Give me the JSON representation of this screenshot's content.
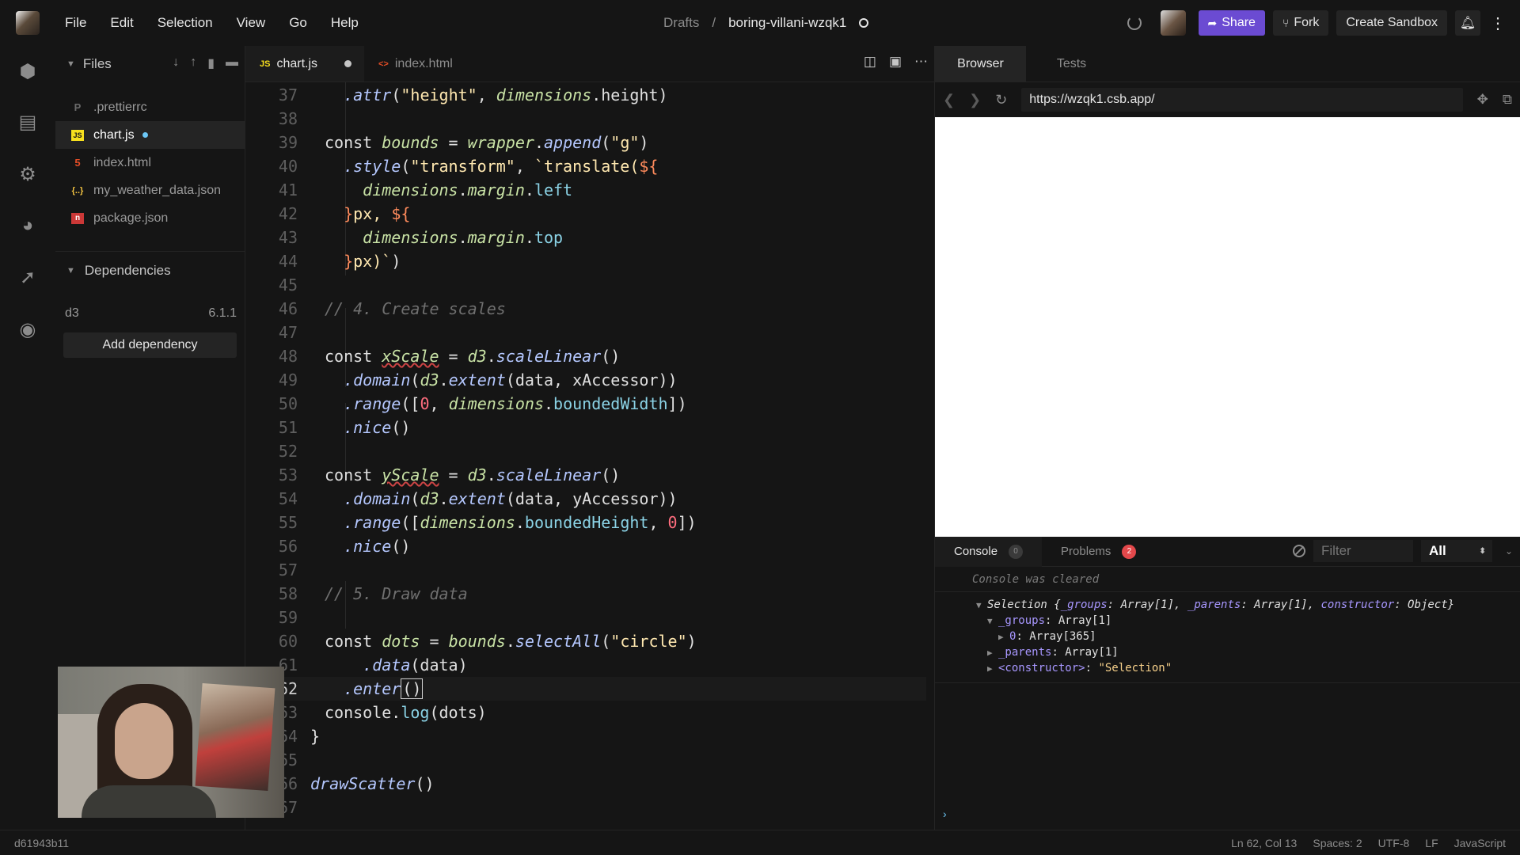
{
  "menu": [
    "File",
    "Edit",
    "Selection",
    "View",
    "Go",
    "Help"
  ],
  "breadcrumb": {
    "folder": "Drafts",
    "separator": "/",
    "sandbox": "boring-villani-wzqk1"
  },
  "header": {
    "share": "Share",
    "fork": "Fork",
    "create": "Create Sandbox"
  },
  "sidebar": {
    "files_title": "Files",
    "files": [
      {
        "name": ".prettierrc",
        "icon": "P"
      },
      {
        "name": "chart.js",
        "icon": "JS"
      },
      {
        "name": "index.html",
        "icon": "5"
      },
      {
        "name": "my_weather_data.json",
        "icon": "{..}"
      },
      {
        "name": "package.json",
        "icon": "n"
      }
    ],
    "deps_title": "Dependencies",
    "deps": [
      {
        "name": "d3",
        "version": "6.1.1"
      }
    ],
    "add_dep": "Add dependency"
  },
  "editor": {
    "tabs": [
      {
        "label": "chart.js",
        "ext": "JS"
      },
      {
        "label": "index.html",
        "ext": "<>"
      }
    ]
  },
  "browser": {
    "tabs": [
      "Browser",
      "Tests"
    ],
    "url": "https://wzqk1.csb.app/"
  },
  "console": {
    "tabs": [
      {
        "label": "Console",
        "count": "0"
      },
      {
        "label": "Problems",
        "count": "2"
      }
    ],
    "filter_placeholder": "Filter",
    "level": "All",
    "cleared": "Console was cleared"
  },
  "status": {
    "hash": "d61943b11",
    "position": "Ln 62, Col 13",
    "spaces": "Spaces: 2",
    "encoding": "UTF-8",
    "eol": "LF",
    "language": "JavaScript"
  }
}
